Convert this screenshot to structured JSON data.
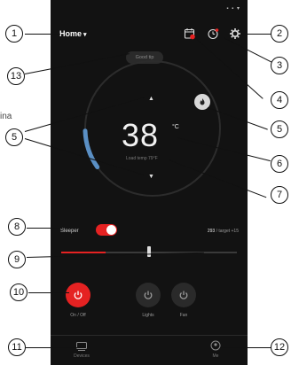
{
  "status": {
    "icons": "▪ ▪ ▾"
  },
  "header": {
    "location": "Home",
    "caret": "▾"
  },
  "icons": {
    "calendar": "calendar-clock-icon",
    "timer": "timer-icon",
    "settings": "gear-icon"
  },
  "pill": {
    "label": "Good tip"
  },
  "thermostat": {
    "temperature": "38",
    "unit": "°C",
    "sublabel": "Load temp 79°F",
    "arc_fill_fraction": 0.3
  },
  "mode": {
    "label": "Sleeper",
    "toggle_on": true
  },
  "level": {
    "value": "293",
    "suffix": "/ target +15"
  },
  "slider": {
    "fraction": 0.5
  },
  "controls": [
    {
      "label": "On / Off",
      "active": true
    },
    {
      "label": "Lights",
      "active": false
    },
    {
      "label": "Fan",
      "active": false
    }
  ],
  "nav": [
    {
      "label": "Devices"
    },
    {
      "label": "Me"
    }
  ],
  "callouts": [
    "1",
    "2",
    "3",
    "4",
    "5",
    "5",
    "6",
    "7",
    "8",
    "9",
    "10",
    "11",
    "12",
    "13"
  ],
  "stray_text": "ina",
  "colors": {
    "accent": "#e52222",
    "arc": "#5a8fc4",
    "background": "#121212"
  }
}
